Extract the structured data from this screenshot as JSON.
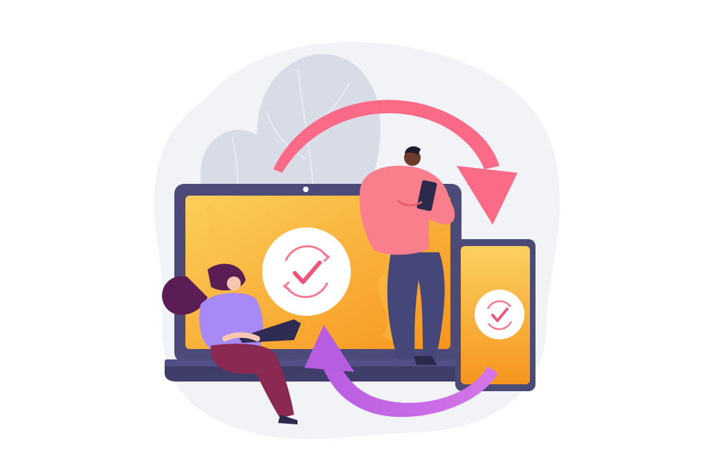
{
  "scene": {
    "background": "#ffffff",
    "blob_color": "#f1f3f7",
    "leaf_color": "#d8dce6",
    "laptop": {
      "frame_color": "#4b4a78",
      "base_color": "#3f3e6b",
      "screen_gradient": [
        "#fbcf59",
        "#f6951e"
      ]
    },
    "phone": {
      "frame_color": "#4b4a78",
      "screen_gradient": [
        "#fbd060",
        "#f6951e"
      ]
    },
    "sync_badge": {
      "circle_color": "#ffffff",
      "arrow_color": "#f57a8d",
      "check_color": "#f0567a"
    },
    "arrow_top_color": "#fb6b87",
    "arrow_bottom_color": "#b75de2",
    "man": {
      "shirt_color": "#fa7f8c",
      "pants_color": "#45467a",
      "skin_color": "#6b3b2a",
      "hair_color": "#1f1a2e"
    },
    "woman": {
      "top_color": "#a78af5",
      "pants_color": "#8a2a52",
      "hair_color": "#5a1e55",
      "skin_color": "#f7c7b1"
    },
    "icons": [
      "laptop-icon",
      "smartphone-icon",
      "sync-check-icon",
      "arrow-icon"
    ]
  }
}
